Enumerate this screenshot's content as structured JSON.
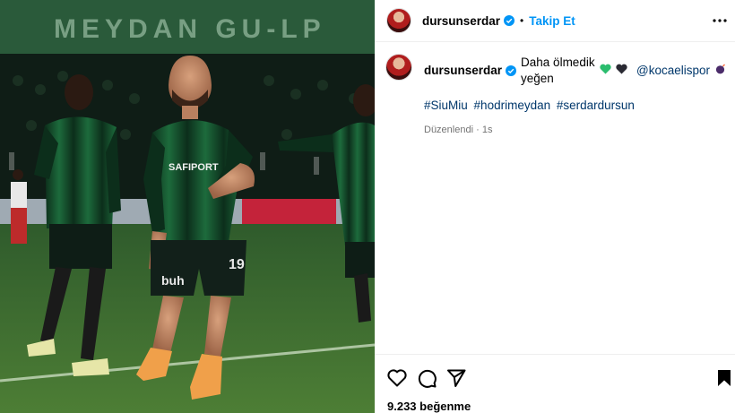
{
  "post": {
    "username": "dursunserdar",
    "follow_label": "Takip Et",
    "separator": "•",
    "caption": {
      "username": "dursunserdar",
      "text": "Daha ölmedik yeğen",
      "mention": "@kocaelispor",
      "hashtags": [
        "#SiuMiu",
        "#hodrimeydan",
        "#serdardursun"
      ],
      "edited_label": "Düzenlendi",
      "time_sep": "·",
      "time": "1s"
    },
    "likes_label": "9.233 beğenme"
  },
  "photo": {
    "banner_text": "MEYDAN GU-LP",
    "shirt_sponsor": "SAFIPORT",
    "short_sponsor": "buh",
    "shirt_number": "19"
  },
  "icons": {
    "verified": "verified-badge-icon",
    "more": "more-options-icon",
    "like": "heart-outline-icon",
    "comment": "comment-icon",
    "share": "send-icon",
    "save": "bookmark-icon"
  },
  "colors": {
    "accent": "#0095f6",
    "link": "#00376b",
    "muted": "#737373",
    "kit_green": "#0f3b24"
  }
}
